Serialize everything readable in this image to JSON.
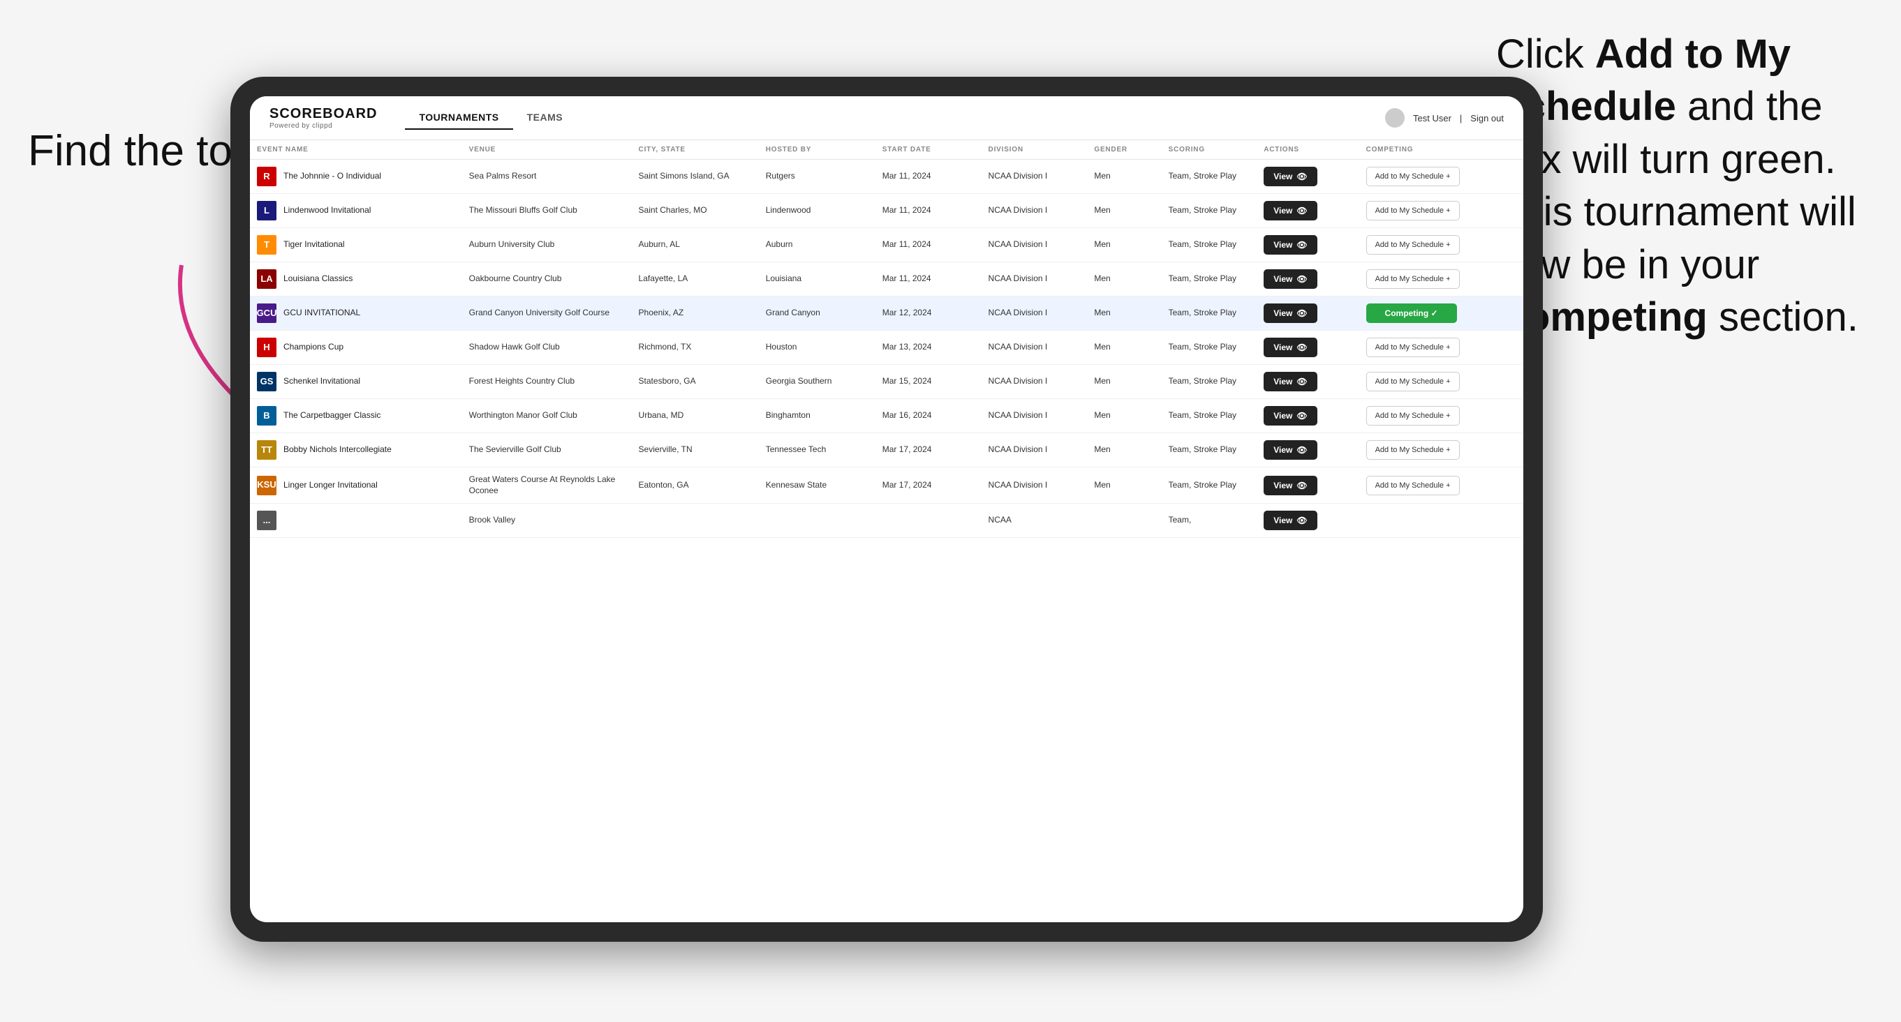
{
  "annotations": {
    "left_title": "Find the tournament.",
    "right_text_prefix": "Click ",
    "right_bold1": "Add to My Schedule",
    "right_text_mid": " and the box will turn green. This tournament will now be in your ",
    "right_bold2": "Competing",
    "right_text_end": " section."
  },
  "header": {
    "logo": "SCOREBOARD",
    "logo_sub": "Powered by clippd",
    "nav": [
      "TOURNAMENTS",
      "TEAMS"
    ],
    "active_nav": "TOURNAMENTS",
    "user": "Test User",
    "signout": "Sign out"
  },
  "table": {
    "columns": [
      "EVENT NAME",
      "VENUE",
      "CITY, STATE",
      "HOSTED BY",
      "START DATE",
      "DIVISION",
      "GENDER",
      "SCORING",
      "ACTIONS",
      "COMPETING"
    ],
    "rows": [
      {
        "logo_color": "#cc0000",
        "logo_text": "R",
        "event": "The Johnnie - O Individual",
        "venue": "Sea Palms Resort",
        "city": "Saint Simons Island, GA",
        "hosted": "Rutgers",
        "date": "Mar 11, 2024",
        "division": "NCAA Division I",
        "gender": "Men",
        "scoring": "Team, Stroke Play",
        "action": "View",
        "competing": "Add to My Schedule +",
        "competing_type": "add",
        "highlighted": false
      },
      {
        "logo_color": "#1a1a7a",
        "logo_text": "L",
        "event": "Lindenwood Invitational",
        "venue": "The Missouri Bluffs Golf Club",
        "city": "Saint Charles, MO",
        "hosted": "Lindenwood",
        "date": "Mar 11, 2024",
        "division": "NCAA Division I",
        "gender": "Men",
        "scoring": "Team, Stroke Play",
        "action": "View",
        "competing": "Add to My Schedule +",
        "competing_type": "add",
        "highlighted": false
      },
      {
        "logo_color": "#ff8c00",
        "logo_text": "T",
        "event": "Tiger Invitational",
        "venue": "Auburn University Club",
        "city": "Auburn, AL",
        "hosted": "Auburn",
        "date": "Mar 11, 2024",
        "division": "NCAA Division I",
        "gender": "Men",
        "scoring": "Team, Stroke Play",
        "action": "View",
        "competing": "Add to My Schedule +",
        "competing_type": "add",
        "highlighted": false
      },
      {
        "logo_color": "#8b0000",
        "logo_text": "LA",
        "event": "Louisiana Classics",
        "venue": "Oakbourne Country Club",
        "city": "Lafayette, LA",
        "hosted": "Louisiana",
        "date": "Mar 11, 2024",
        "division": "NCAA Division I",
        "gender": "Men",
        "scoring": "Team, Stroke Play",
        "action": "View",
        "competing": "Add to My Schedule +",
        "competing_type": "add",
        "highlighted": false
      },
      {
        "logo_color": "#4a1a8a",
        "logo_text": "GCU",
        "event": "GCU INVITATIONAL",
        "venue": "Grand Canyon University Golf Course",
        "city": "Phoenix, AZ",
        "hosted": "Grand Canyon",
        "date": "Mar 12, 2024",
        "division": "NCAA Division I",
        "gender": "Men",
        "scoring": "Team, Stroke Play",
        "action": "View",
        "competing": "Competing ✓",
        "competing_type": "competing",
        "highlighted": true
      },
      {
        "logo_color": "#cc0000",
        "logo_text": "H",
        "event": "Champions Cup",
        "venue": "Shadow Hawk Golf Club",
        "city": "Richmond, TX",
        "hosted": "Houston",
        "date": "Mar 13, 2024",
        "division": "NCAA Division I",
        "gender": "Men",
        "scoring": "Team, Stroke Play",
        "action": "View",
        "competing": "Add to My Schedule +",
        "competing_type": "add",
        "highlighted": false
      },
      {
        "logo_color": "#003366",
        "logo_text": "GS",
        "event": "Schenkel Invitational",
        "venue": "Forest Heights Country Club",
        "city": "Statesboro, GA",
        "hosted": "Georgia Southern",
        "date": "Mar 15, 2024",
        "division": "NCAA Division I",
        "gender": "Men",
        "scoring": "Team, Stroke Play",
        "action": "View",
        "competing": "Add to My Schedule +",
        "competing_type": "add",
        "highlighted": false
      },
      {
        "logo_color": "#005f99",
        "logo_text": "B",
        "event": "The Carpetbagger Classic",
        "venue": "Worthington Manor Golf Club",
        "city": "Urbana, MD",
        "hosted": "Binghamton",
        "date": "Mar 16, 2024",
        "division": "NCAA Division I",
        "gender": "Men",
        "scoring": "Team, Stroke Play",
        "action": "View",
        "competing": "Add to My Schedule +",
        "competing_type": "add",
        "highlighted": false
      },
      {
        "logo_color": "#b8860b",
        "logo_text": "TT",
        "event": "Bobby Nichols Intercollegiate",
        "venue": "The Sevierville Golf Club",
        "city": "Sevierville, TN",
        "hosted": "Tennessee Tech",
        "date": "Mar 17, 2024",
        "division": "NCAA Division I",
        "gender": "Men",
        "scoring": "Team, Stroke Play",
        "action": "View",
        "competing": "Add to My Schedule +",
        "competing_type": "add",
        "highlighted": false
      },
      {
        "logo_color": "#cc6600",
        "logo_text": "KSU",
        "event": "Linger Longer Invitational",
        "venue": "Great Waters Course At Reynolds Lake Oconee",
        "city": "Eatonton, GA",
        "hosted": "Kennesaw State",
        "date": "Mar 17, 2024",
        "division": "NCAA Division I",
        "gender": "Men",
        "scoring": "Team, Stroke Play",
        "action": "View",
        "competing": "Add to My Schedule +",
        "competing_type": "add",
        "highlighted": false
      },
      {
        "logo_color": "#555",
        "logo_text": "...",
        "event": "",
        "venue": "Brook Valley",
        "city": "",
        "hosted": "",
        "date": "",
        "division": "NCAA",
        "gender": "",
        "scoring": "Team,",
        "action": "View",
        "competing": "",
        "competing_type": "add",
        "highlighted": false
      }
    ]
  }
}
